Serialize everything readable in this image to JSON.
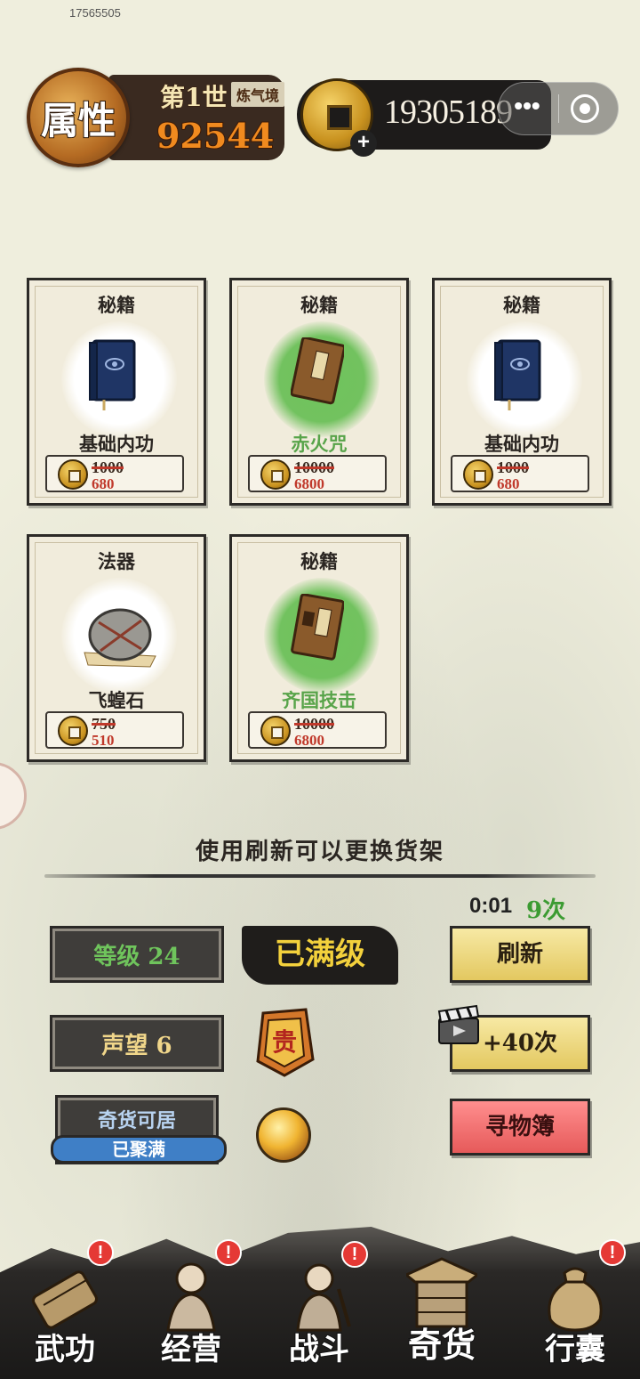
{
  "header": {
    "uid": "17565505",
    "attr_label": "属性",
    "generation": "第1世",
    "realm": "炼气境",
    "power": "92544",
    "coins": "19305189",
    "coin_plus": "+",
    "capsule_more": "•••"
  },
  "shop": {
    "items": [
      {
        "type": "秘籍",
        "name": "基础内功",
        "old_price": "1000",
        "new_price": "680",
        "rarity": "white",
        "icon": "blue-book-icon"
      },
      {
        "type": "秘籍",
        "name": "赤火咒",
        "old_price": "10000",
        "new_price": "6800",
        "rarity": "green",
        "icon": "brown-book-icon"
      },
      {
        "type": "秘籍",
        "name": "基础内功",
        "old_price": "1000",
        "new_price": "680",
        "rarity": "white",
        "icon": "blue-book-icon"
      },
      {
        "type": "法器",
        "name": "飞蝗石",
        "old_price": "750",
        "new_price": "510",
        "rarity": "white",
        "icon": "stone-icon"
      },
      {
        "type": "秘籍",
        "name": "齐国技击",
        "old_price": "10000",
        "new_price": "6800",
        "rarity": "green",
        "icon": "brown-book-icon"
      }
    ],
    "hint": "使用刷新可以更换货架"
  },
  "controls": {
    "timer": "0:01",
    "times": "9次",
    "level": "等级 24",
    "maxed": "已满级",
    "reputation": "声望 6",
    "honor_char": "贵",
    "qihuo_title": "奇货可居",
    "qihuo_status": "已聚满",
    "refresh": "刷新",
    "plus_times": "+40次",
    "book": "寻物簿"
  },
  "nav": {
    "items": [
      {
        "label": "武功",
        "badge": "!"
      },
      {
        "label": "经营",
        "badge": "!"
      },
      {
        "label": "战斗",
        "badge": "!"
      },
      {
        "label": "奇货",
        "badge": ""
      },
      {
        "label": "行囊",
        "badge": "!"
      }
    ],
    "active_index": 3
  },
  "colors": {
    "background": "#efeedd",
    "green_text": "#58a44a",
    "price_red": "#c0392b",
    "coin_gold": "#c9921f",
    "level_green": "#6fc45c",
    "maxed_yellow": "#f3d13c"
  }
}
